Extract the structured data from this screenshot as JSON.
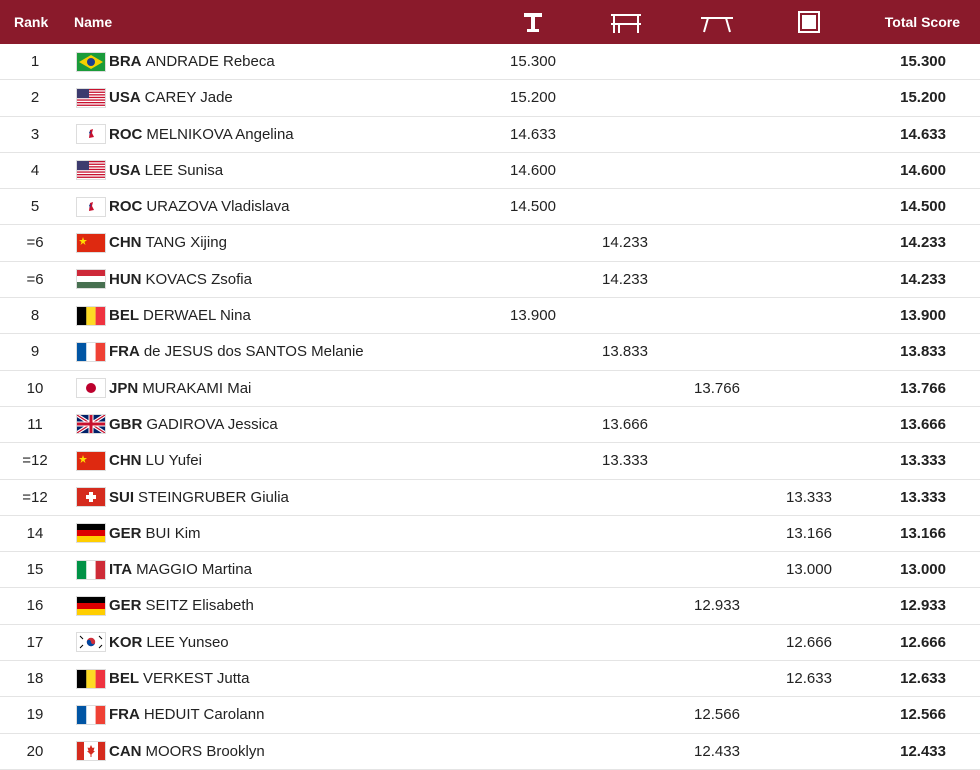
{
  "header": {
    "rank": "Rank",
    "name": "Name",
    "total": "Total Score"
  },
  "apparatus_icons": [
    "vault-icon",
    "uneven-bars-icon",
    "balance-beam-icon",
    "floor-exercise-icon"
  ],
  "rows": [
    {
      "rank": "1",
      "noc": "BRA",
      "name": "ANDRADE Rebeca",
      "vault": "15.300",
      "bars": "",
      "beam": "",
      "floor": "",
      "total": "15.300"
    },
    {
      "rank": "2",
      "noc": "USA",
      "name": "CAREY Jade",
      "vault": "15.200",
      "bars": "",
      "beam": "",
      "floor": "",
      "total": "15.200"
    },
    {
      "rank": "3",
      "noc": "ROC",
      "name": "MELNIKOVA Angelina",
      "vault": "14.633",
      "bars": "",
      "beam": "",
      "floor": "",
      "total": "14.633"
    },
    {
      "rank": "4",
      "noc": "USA",
      "name": "LEE Sunisa",
      "vault": "14.600",
      "bars": "",
      "beam": "",
      "floor": "",
      "total": "14.600"
    },
    {
      "rank": "5",
      "noc": "ROC",
      "name": "URAZOVA Vladislava",
      "vault": "14.500",
      "bars": "",
      "beam": "",
      "floor": "",
      "total": "14.500"
    },
    {
      "rank": "=6",
      "noc": "CHN",
      "name": "TANG Xijing",
      "vault": "",
      "bars": "14.233",
      "beam": "",
      "floor": "",
      "total": "14.233"
    },
    {
      "rank": "=6",
      "noc": "HUN",
      "name": "KOVACS Zsofia",
      "vault": "",
      "bars": "14.233",
      "beam": "",
      "floor": "",
      "total": "14.233"
    },
    {
      "rank": "8",
      "noc": "BEL",
      "name": "DERWAEL Nina",
      "vault": "13.900",
      "bars": "",
      "beam": "",
      "floor": "",
      "total": "13.900"
    },
    {
      "rank": "9",
      "noc": "FRA",
      "name": "de JESUS dos SANTOS Melanie",
      "vault": "",
      "bars": "13.833",
      "beam": "",
      "floor": "",
      "total": "13.833"
    },
    {
      "rank": "10",
      "noc": "JPN",
      "name": "MURAKAMI Mai",
      "vault": "",
      "bars": "",
      "beam": "13.766",
      "floor": "",
      "total": "13.766"
    },
    {
      "rank": "11",
      "noc": "GBR",
      "name": "GADIROVA Jessica",
      "vault": "",
      "bars": "13.666",
      "beam": "",
      "floor": "",
      "total": "13.666"
    },
    {
      "rank": "=12",
      "noc": "CHN",
      "name": "LU Yufei",
      "vault": "",
      "bars": "13.333",
      "beam": "",
      "floor": "",
      "total": "13.333"
    },
    {
      "rank": "=12",
      "noc": "SUI",
      "name": "STEINGRUBER Giulia",
      "vault": "",
      "bars": "",
      "beam": "",
      "floor": "13.333",
      "total": "13.333"
    },
    {
      "rank": "14",
      "noc": "GER",
      "name": "BUI Kim",
      "vault": "",
      "bars": "",
      "beam": "",
      "floor": "13.166",
      "total": "13.166"
    },
    {
      "rank": "15",
      "noc": "ITA",
      "name": "MAGGIO Martina",
      "vault": "",
      "bars": "",
      "beam": "",
      "floor": "13.000",
      "total": "13.000"
    },
    {
      "rank": "16",
      "noc": "GER",
      "name": "SEITZ Elisabeth",
      "vault": "",
      "bars": "",
      "beam": "12.933",
      "floor": "",
      "total": "12.933"
    },
    {
      "rank": "17",
      "noc": "KOR",
      "name": "LEE Yunseo",
      "vault": "",
      "bars": "",
      "beam": "",
      "floor": "12.666",
      "total": "12.666"
    },
    {
      "rank": "18",
      "noc": "BEL",
      "name": "VERKEST Jutta",
      "vault": "",
      "bars": "",
      "beam": "",
      "floor": "12.633",
      "total": "12.633"
    },
    {
      "rank": "19",
      "noc": "FRA",
      "name": "HEDUIT Carolann",
      "vault": "",
      "bars": "",
      "beam": "12.566",
      "floor": "",
      "total": "12.566"
    },
    {
      "rank": "20",
      "noc": "CAN",
      "name": "MOORS Brooklyn",
      "vault": "",
      "bars": "",
      "beam": "12.433",
      "floor": "",
      "total": "12.433"
    }
  ],
  "colors": {
    "header_bg": "#8a1a2b",
    "header_text": "#ffffff",
    "row_border": "#e4e4e4"
  }
}
